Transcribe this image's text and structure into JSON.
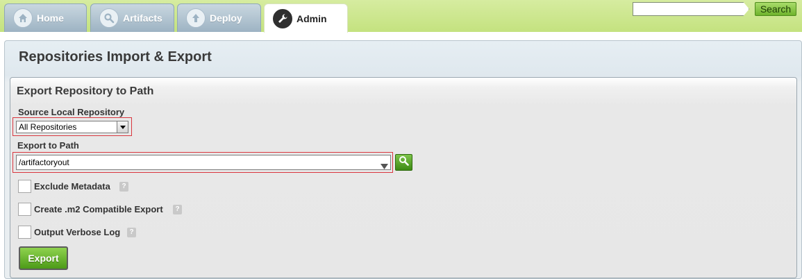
{
  "nav": {
    "tabs": [
      {
        "label": "Home",
        "icon": "home-icon"
      },
      {
        "label": "Artifacts",
        "icon": "search-icon"
      },
      {
        "label": "Deploy",
        "icon": "upload-arrow-icon"
      },
      {
        "label": "Admin",
        "icon": "wrench-icon",
        "active": true
      }
    ],
    "search": {
      "value": "",
      "button_label": "Search"
    }
  },
  "page": {
    "title": "Repositories Import & Export"
  },
  "export_section": {
    "title": "Export Repository to Path",
    "source_label": "Source Local Repository",
    "source_value": "All Repositories",
    "path_label": "Export to Path",
    "path_value": "/artifactoryout",
    "options": [
      {
        "label": "Exclude Metadata",
        "checked": false,
        "help": "?"
      },
      {
        "label": "Create .m2 Compatible Export",
        "checked": false,
        "help": "?"
      },
      {
        "label": "Output Verbose Log",
        "checked": false,
        "help": "?"
      }
    ],
    "export_button": "Export"
  },
  "colors": {
    "nav_band": "#c4e27f",
    "accent_green": "#5aa51f",
    "highlight_red": "#d9363e"
  }
}
